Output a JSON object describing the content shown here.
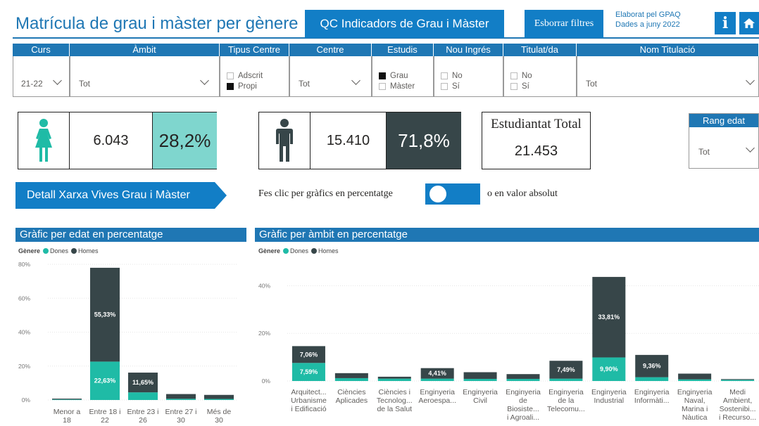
{
  "header": {
    "title": "Matrícula de grau i màster per gènere",
    "qc_button": "QC Indicadors de Grau i Màster",
    "clear_filters": "Esborrar filtres",
    "credit_line1": "Elaborat pel GPAQ",
    "credit_line2": "Dades a juny 2022",
    "info_icon": "info-icon",
    "home_icon": "home-icon",
    "accent_color": "#127ec6"
  },
  "filters": {
    "curs": {
      "label": "Curs",
      "value": "21-22"
    },
    "ambit": {
      "label": "Àmbit",
      "value": "Tot"
    },
    "tipus_centre": {
      "label": "Tipus Centre",
      "options": [
        {
          "label": "Adscrit",
          "checked": false
        },
        {
          "label": "Propi",
          "checked": true
        }
      ]
    },
    "centre": {
      "label": "Centre",
      "value": "Tot"
    },
    "estudis": {
      "label": "Estudis",
      "options": [
        {
          "label": "Grau",
          "checked": true
        },
        {
          "label": "Màster",
          "checked": false
        }
      ]
    },
    "nou_ingres": {
      "label": "Nou Ingrés",
      "options": [
        {
          "label": "No",
          "checked": false
        },
        {
          "label": "Sí",
          "checked": false
        }
      ]
    },
    "titulat": {
      "label": "Titulat/da",
      "options": [
        {
          "label": "No",
          "checked": false
        },
        {
          "label": "Sí",
          "checked": false
        }
      ]
    },
    "nom_titulacio": {
      "label": "Nom Titulació",
      "value": "Tot"
    }
  },
  "kpis": {
    "women": {
      "icon": "female-icon",
      "count": "6.043",
      "percent": "28,2%",
      "color": "#1fbba6"
    },
    "men": {
      "icon": "male-icon",
      "count": "15.410",
      "percent": "71,8%",
      "color": "#374649"
    },
    "total": {
      "label": "Estudiantat Total",
      "value": "21.453"
    },
    "age_range": {
      "label": "Rang edat",
      "value": "Tot"
    }
  },
  "banner": {
    "detail_button": "Detall Xarxa Vives Grau i Màster",
    "toggle_text_before": "Fes clic per gràfics en percentatge",
    "toggle_text_after": "o en valor absolut"
  },
  "chart_data": [
    {
      "type": "bar",
      "stacked": true,
      "title": "Gràfic per edat en percentatge",
      "legend_title": "Gènere",
      "ylim": [
        0,
        80
      ],
      "yticks": [
        "0%",
        "20%",
        "40%",
        "60%",
        "80%"
      ],
      "categories": [
        "Menor a 18",
        "Entre 18 i 22",
        "Entre 23 i 26",
        "Entre 27 i 30",
        "Més de 30"
      ],
      "category_lines": [
        [
          "Menor a",
          "18"
        ],
        [
          "Entre 18 i",
          "22"
        ],
        [
          "Entre 23 i",
          "26"
        ],
        [
          "Entre 27 i",
          "30"
        ],
        [
          "Més de",
          "30"
        ]
      ],
      "series": [
        {
          "name": "Dones",
          "color": "#1fbba6",
          "values": [
            0.3,
            22.63,
            4.5,
            0.7,
            0.6
          ],
          "labels": [
            "",
            "22,63%",
            "",
            "",
            ""
          ]
        },
        {
          "name": "Homes",
          "color": "#374649",
          "values": [
            0.5,
            55.33,
            11.65,
            2.8,
            2.4
          ],
          "labels": [
            "",
            "55,33%",
            "11,65%",
            "",
            ""
          ]
        }
      ]
    },
    {
      "type": "bar",
      "stacked": true,
      "title": "Gràfic per àmbit en percentatge",
      "legend_title": "Gènere",
      "ylim": [
        0,
        49
      ],
      "yticks": [
        "0%",
        "20%",
        "40%"
      ],
      "categories": [
        "Arquitect... Urbanisme i Edificació",
        "Ciències Aplicades",
        "Ciències i Tecnolog... de la Salut",
        "Enginyeria Aeroespa...",
        "Enginyeria Civil",
        "Enginyeria de Biosiste... i Agroali...",
        "Enginyeria de la Telecomu...",
        "Enginyeria Industrial",
        "Enginyeria Informàti...",
        "Enginyeria Naval, Marina i Nàutica",
        "Medi Ambient, Sostenibi... i Recurso..."
      ],
      "category_lines": [
        [
          "Arquitect...",
          "Urbanisme",
          "i Edificació"
        ],
        [
          "Ciències",
          "Aplicades"
        ],
        [
          "Ciències i",
          "Tecnolog...",
          "de la Salut"
        ],
        [
          "Enginyeria",
          "Aeroespa..."
        ],
        [
          "Enginyeria",
          "Civil"
        ],
        [
          "Enginyeria",
          "de",
          "Biosiste...",
          "i Agroali..."
        ],
        [
          "Enginyeria",
          "de la",
          "Telecomu..."
        ],
        [
          "Enginyeria",
          "Industrial"
        ],
        [
          "Enginyeria",
          "Informàti..."
        ],
        [
          "Enginyeria",
          "Naval,",
          "Marina i",
          "Nàutica"
        ],
        [
          "Medi",
          "Ambient,",
          "Sostenibi...",
          "i Recurso..."
        ]
      ],
      "series": [
        {
          "name": "Dones",
          "color": "#1fbba6",
          "values": [
            7.59,
            1.2,
            1.0,
            1.0,
            0.9,
            0.9,
            1.0,
            9.9,
            1.6,
            0.7,
            0.5
          ],
          "labels": [
            "7,59%",
            "",
            "",
            "",
            "",
            "",
            "",
            "9,90%",
            "",
            "",
            ""
          ]
        },
        {
          "name": "Homes",
          "color": "#374649",
          "values": [
            7.06,
            2.1,
            0.8,
            4.41,
            2.8,
            2.0,
            7.49,
            33.81,
            9.36,
            2.4,
            0.3
          ],
          "labels": [
            "7,06%",
            "",
            "",
            "4,41%",
            "",
            "",
            "7,49%",
            "33,81%",
            "9,36%",
            "",
            ""
          ]
        }
      ]
    }
  ]
}
